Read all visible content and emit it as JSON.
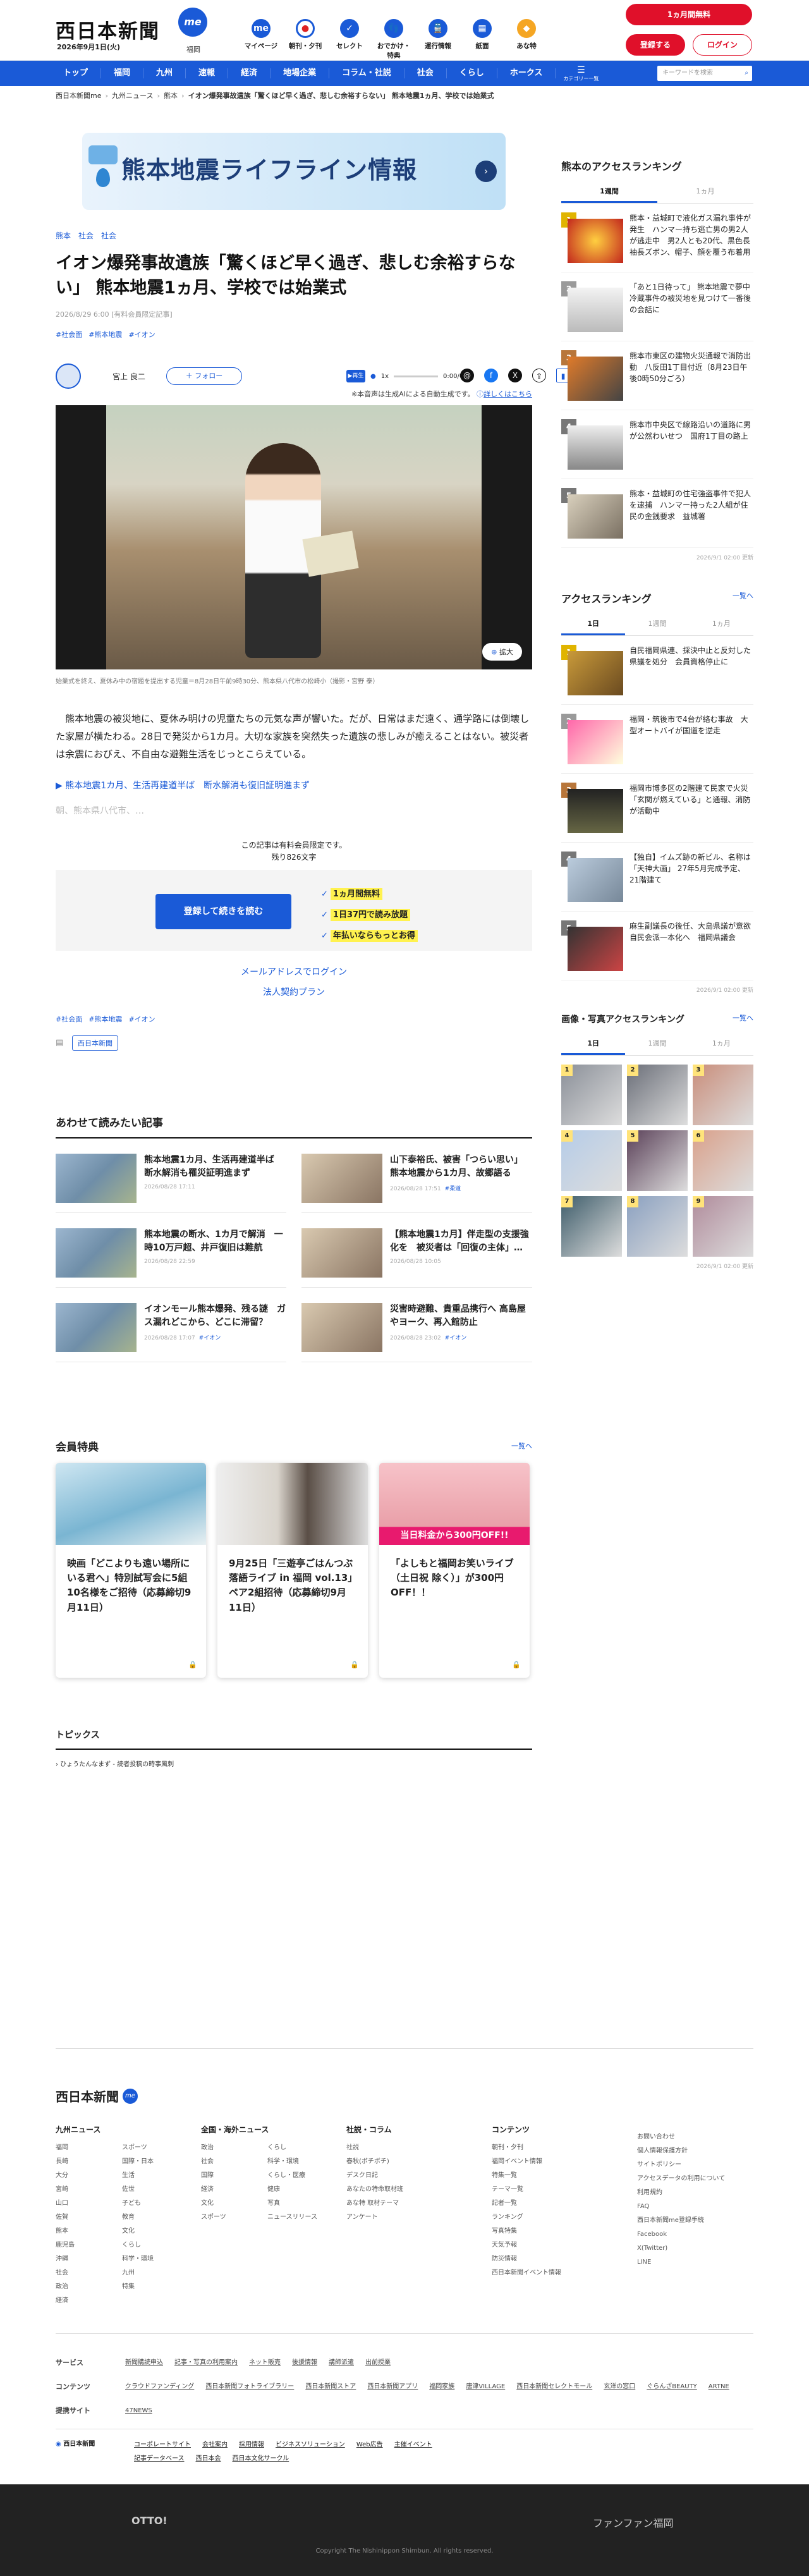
{
  "header": {
    "logo": "西日本新聞",
    "me": "me",
    "date": "2026年9月1日(火)",
    "location": "福岡",
    "nav": [
      {
        "label": "マイページ",
        "icon": "me-icon"
      },
      {
        "label": "朝刊・夕刊",
        "icon": "newspaper-icon"
      },
      {
        "label": "セレクト",
        "icon": "select-icon"
      },
      {
        "label": "おでかけ・特典",
        "icon": "footprint-icon"
      },
      {
        "label": "運行情報",
        "icon": "train-icon"
      },
      {
        "label": "紙面",
        "icon": "paper-icon"
      },
      {
        "label": "あな特",
        "icon": "anataku-icon"
      }
    ],
    "trial": "1ヵ月間無料",
    "register": "登録する",
    "login": "ログイン"
  },
  "globalnav": {
    "items": [
      "トップ",
      "福岡",
      "九州",
      "速報",
      "経済",
      "地場企業",
      "コラム・社説",
      "社会",
      "くらし",
      "ホークス"
    ],
    "category": "カテゴリー一覧",
    "search_placeholder": "キーワードを検索"
  },
  "breadcrumb": [
    "西日本新聞me",
    "九州ニュース",
    "熊本",
    "イオン爆発事故遺族「驚くほど早く過ぎ、悲しむ余裕すらない」 熊本地震1ヵ月、学校では始業式"
  ],
  "banner": "熊本地震ライフライン情報",
  "article": {
    "tags_top": [
      "熊本",
      "社会",
      "社会"
    ],
    "title": "イオン爆発事故遺族「驚くほど早く過ぎ、悲しむ余裕すらない」 熊本地震1ヵ月、学校では始業式",
    "published": "2026/8/29 6:00 [有料会員限定記事]",
    "hashtags": [
      "#社会面",
      "#熊本地震",
      "#イオン"
    ],
    "author": "宮上 良二",
    "follow": "＋ フォロー",
    "audio_play": "▶再生",
    "audio_speed": "1x",
    "audio_time": "0:00/0:00",
    "ai_note": "※本音声は生成AIによる自動生成です。",
    "ai_more": "詳しくはこちら",
    "enlarge": "拡大",
    "caption": "始業式を終え、夏休み中の宿題を提出する児童＝8月28日午前9時30分、熊本県八代市の松崎小（撮影・宮野 泰）",
    "body": "熊本地震の被災地に、夏休み明けの児童たちの元気な声が響いた。だが、日常はまだ遠く、通学路には倒壊した家屋が横たわる。28日で発災から1カ月。大切な家族を突然失った遺族の悲しみが癒えることはない。被災者は余震におびえ、不自由な避難生活をじっとこらえている。",
    "related": "熊本地震1カ月、生活再建道半ば　断水解消も復旧証明進まず",
    "fade": "朝、熊本県八代市、…",
    "pw_notice": "この記事は有料会員限定です。",
    "pw_remain": "残り826文字",
    "pw_button": "登録して続きを読む",
    "pw_benefits": [
      "1ヵ月間無料",
      "1日37円で読み放題",
      "年払いならもっとお得"
    ],
    "login_email": "メールアドレスでログイン",
    "corporate": "法人契約プラン",
    "chip": "西日本新聞"
  },
  "related": {
    "title": "あわせて読みたい記事",
    "items": [
      {
        "title": "熊本地震1カ月、生活再建道半ば　断水解消も罹災証明進まず",
        "date": "2026/08/28 17:11",
        "tag": ""
      },
      {
        "title": "山下泰裕氏、被害「つらい思い」 熊本地震から1カ月、故郷語る",
        "date": "2026/08/28 17:51",
        "tag": "#柔道"
      },
      {
        "title": "熊本地震の断水、1カ月で解消　一時10万戸超、井戸復旧は難航",
        "date": "2026/08/28 22:59",
        "tag": ""
      },
      {
        "title": "【熊本地震1カ月】伴走型の支援強化を　被災者は「回復の主体」…",
        "date": "2026/08/28 10:05",
        "tag": ""
      },
      {
        "title": "イオンモール熊本爆発、残る謎　ガス漏れどこから、どこに滞留？",
        "date": "2026/08/28 17:07",
        "tag": "#イオン"
      },
      {
        "title": "災害時避難、貴重品携行へ 高島屋やヨーク、再入館防止",
        "date": "2026/08/28 23:02",
        "tag": "#イオン"
      }
    ]
  },
  "perks": {
    "title": "会員特典",
    "more": "一覧へ",
    "items": [
      "映画「どこよりも遠い場所にいる君へ」特別試写会に5組10名様をご招待（応募締切9月11日）",
      "9月25日「三遊亭ごはんつぶ 落語ライブ in 福岡 vol.13」ペア2組招待（応募締切9月11日）",
      "「よしもと福岡お笑いライブ（土日祝 除く）」が300円OFF！！"
    ],
    "banner_text": "当日料金から300円OFF!!"
  },
  "topics": {
    "title": "トピックス",
    "item": "ひょうたんなまず - 読者投稿の時事風刺"
  },
  "sidebar": {
    "kumamoto": {
      "title": "熊本のアクセスランキング",
      "tabs": [
        "1週間",
        "1ヵ月"
      ],
      "items": [
        "熊本・益城町で液化ガス漏れ事件が発生　ハンマー持ち逃亡男の男2人が逃走中　男2人とも20代、黒色長袖長ズボン、帽子、顔を覆う布着用",
        "「あと1日待って」 熊本地震で夢中冷蔵事件の被災地を見つけて一番後の会話に",
        "熊本市東区の建物火災通報で消防出動　八反田1丁目付近（8月23日午後0時50分ごろ）",
        "熊本市中央区で線路沿いの道路に男が公然わいせつ　国府1丁目の路上",
        "熊本・益城町の住宅強盗事件で犯人を逮捕　ハンマー持った2人組が住民の金銭要求　益城署"
      ],
      "updated": "2026/9/1 02:00 更新"
    },
    "access": {
      "title": "アクセスランキング",
      "more": "一覧へ",
      "tabs": [
        "1日",
        "1週間",
        "1ヵ月"
      ],
      "items": [
        "自民福岡県連、採決中止と反対した県議を処分　会員資格停止に",
        "福岡・筑後市で4台が絡む事故　大型オートバイが国道を逆走",
        "福岡市博多区の2階建て民家で火災「玄関が燃えている」と通報、消防が活動中",
        "【独自】イムズ跡の新ビル、名称は「天神大画」 27年5月完成予定、21階建て",
        "麻生副議長の後任、大島県議が意欲　自民会派一本化へ　福岡県議会"
      ],
      "updated": "2026/9/1 02:00 更新"
    },
    "photo": {
      "title": "画像・写真アクセスランキング",
      "more": "一覧へ",
      "tabs": [
        "1日",
        "1週間",
        "1ヵ月"
      ],
      "updated": "2026/9/1 02:00 更新"
    }
  },
  "footer": {
    "logo": "西日本新聞",
    "cols": [
      {
        "title": "九州ニュース",
        "items": [
          "福岡",
          "長崎",
          "大分",
          "宮崎",
          "山口",
          "佐賀",
          "熊本",
          "鹿児島",
          "沖縄",
          "社会",
          "政治",
          "経済",
          "スポーツ",
          "国際・日本",
          "生活",
          "佐世",
          "子ども",
          "教育",
          "文化",
          "くらし",
          "科学・環境",
          "九州",
          "特集"
        ]
      },
      {
        "title": "全国・海外ニュース",
        "items": [
          "政治",
          "社会",
          "国際",
          "経済",
          "文化",
          "スポーツ",
          "くらし",
          "科学・環境",
          "くらし・医療",
          "健康",
          "写真",
          "ニュースリリース"
        ]
      },
      {
        "title": "社説・コラム",
        "items": [
          "社説",
          "春秋(ボチボチ)",
          "デスク日記",
          "あなたの特命取材班",
          "あな特 取材テーマ",
          "アンケート"
        ]
      },
      {
        "title": "コンテンツ",
        "items": [
          "朝刊・夕刊",
          "福岡イベント情報",
          "特集一覧",
          "テーマ一覧",
          "記者一覧",
          "ランキング",
          "写真特集",
          "天気予報",
          "防災情報",
          "西日本新聞イベント情報"
        ]
      },
      {
        "title": "",
        "items": [
          "お問い合わせ",
          "個人情報保護方針",
          "サイトポリシー",
          "アクセスデータの利用について",
          "利用規約",
          "FAQ",
          "西日本新聞me登録手続",
          "Facebook",
          "X(Twitter)",
          "LINE"
        ]
      }
    ],
    "rows": [
      {
        "label": "サービス",
        "items": [
          "新聞購読申込",
          "記事・写真の利用案内",
          "ネット販売",
          "後援情報",
          "講師派遣",
          "出前授業"
        ]
      },
      {
        "label": "コンテンツ",
        "items": [
          "クラウドファンディング",
          "西日本新聞フォトライブラリー",
          "西日本新聞ストア",
          "西日本新聞アプリ",
          "福岡家族",
          "唐津VILLAGE",
          "西日本新聞セレクトモール",
          "玄洋の窓口",
          "ぐらんざBEAUTY",
          "ARTNE"
        ]
      },
      {
        "label": "提携サイト",
        "items": [
          "47NEWS"
        ]
      }
    ],
    "company": [
      "コーポレートサイト",
      "会社案内",
      "採用情報",
      "ビジネスソリューション",
      "Web広告",
      "主催イベント",
      "記事データベース",
      "西日本会",
      "西日本文化サークル"
    ],
    "company_logo": "西日本新聞",
    "sponsor": "OTTO!",
    "fanfan": "ファンファン福岡",
    "copyright": "Copyright The Nishinippon Shimbun. All rights reserved."
  },
  "colors": {
    "brand": "#1a5ad7",
    "accent": "#e0102a",
    "highlight": "#fff24f"
  }
}
